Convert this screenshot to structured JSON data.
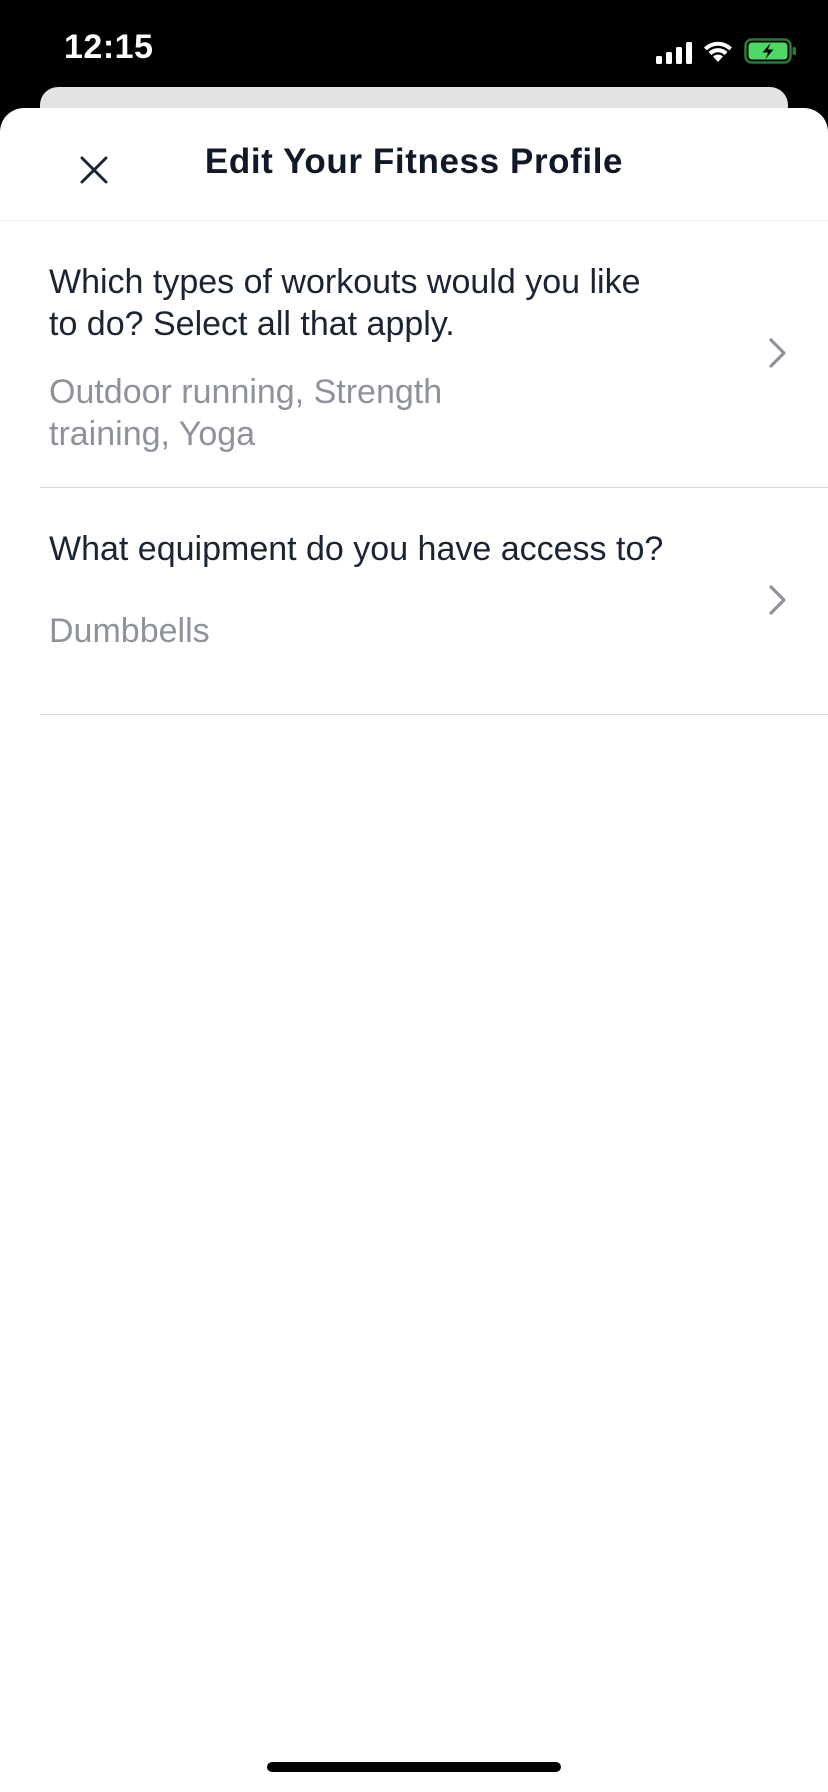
{
  "status_bar": {
    "time": "12:15",
    "icons": [
      "signal-icon",
      "wifi-icon",
      "battery-charging-icon"
    ]
  },
  "header": {
    "title": "Edit Your Fitness Profile",
    "close_icon": "close-icon"
  },
  "items": [
    {
      "question": "Which types of workouts would you like to do? Select all that apply.",
      "answer": "Outdoor running, Strength training, Yoga",
      "icon": "chevron-right-icon"
    },
    {
      "question": "What equipment do you have access to?",
      "answer": "Dumbbells",
      "icon": "chevron-right-icon"
    }
  ],
  "colors": {
    "title": "#111827",
    "question": "#1a2433",
    "answer": "#8e939b",
    "battery": "#4cd964",
    "divider": "#d7d9dc"
  }
}
